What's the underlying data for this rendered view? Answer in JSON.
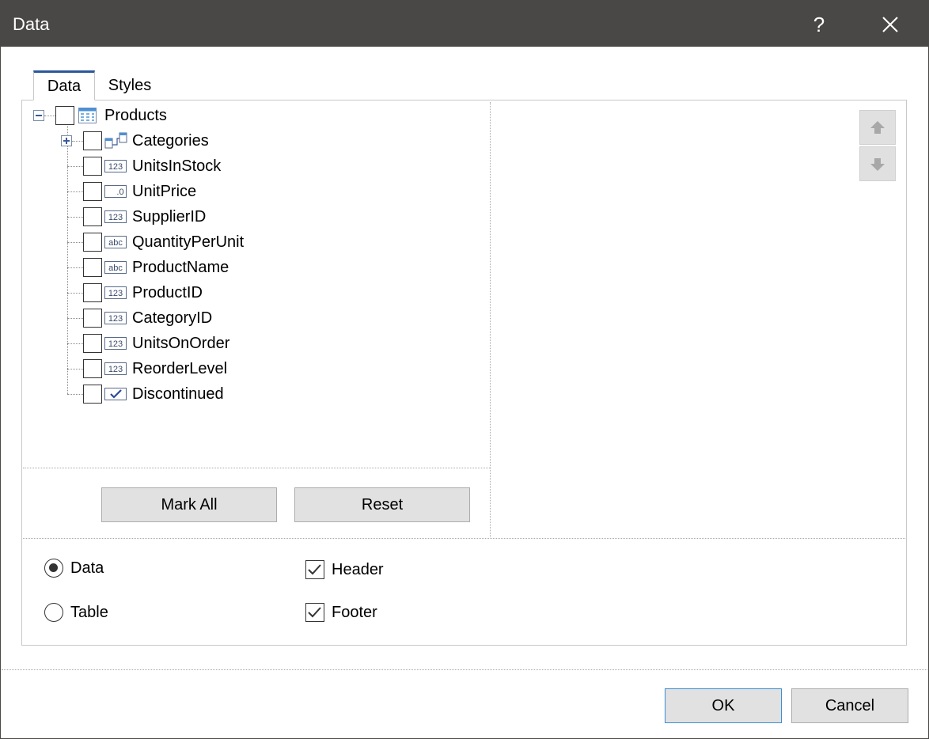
{
  "window": {
    "title": "Data",
    "help_label": "?"
  },
  "tabs": [
    {
      "label": "Data",
      "active": true
    },
    {
      "label": "Styles",
      "active": false
    }
  ],
  "tree": {
    "root": {
      "label": "Products",
      "icon": "table-icon",
      "expanded": true,
      "checked": false
    },
    "children": [
      {
        "label": "Categories",
        "icon": "relation-icon",
        "type_text": "",
        "expandable": true,
        "checked": false
      },
      {
        "label": "UnitsInStock",
        "icon": "number-field-icon",
        "type_text": "123",
        "checked": false
      },
      {
        "label": "UnitPrice",
        "icon": "decimal-field-icon",
        "type_text": ".0",
        "checked": false
      },
      {
        "label": "SupplierID",
        "icon": "number-field-icon",
        "type_text": "123",
        "checked": false
      },
      {
        "label": "QuantityPerUnit",
        "icon": "text-field-icon",
        "type_text": "abc",
        "checked": false
      },
      {
        "label": "ProductName",
        "icon": "text-field-icon",
        "type_text": "abc",
        "checked": false
      },
      {
        "label": "ProductID",
        "icon": "number-field-icon",
        "type_text": "123",
        "checked": false
      },
      {
        "label": "CategoryID",
        "icon": "number-field-icon",
        "type_text": "123",
        "checked": false
      },
      {
        "label": "UnitsOnOrder",
        "icon": "number-field-icon",
        "type_text": "123",
        "checked": false
      },
      {
        "label": "ReorderLevel",
        "icon": "number-field-icon",
        "type_text": "123",
        "checked": false
      },
      {
        "label": "Discontinued",
        "icon": "boolean-field-icon",
        "type_text": "",
        "checked": false
      }
    ]
  },
  "buttons": {
    "mark_all": "Mark All",
    "reset": "Reset",
    "ok": "OK",
    "cancel": "Cancel"
  },
  "options": {
    "mode": [
      {
        "label": "Data",
        "selected": true
      },
      {
        "label": "Table",
        "selected": false
      }
    ],
    "header": {
      "label": "Header",
      "checked": true
    },
    "footer": {
      "label": "Footer",
      "checked": true
    }
  },
  "colors": {
    "titlebar": "#4a4846",
    "accent": "#2b579a",
    "button_face": "#e1e1e1",
    "icon_blue": "#3a5a9a"
  }
}
